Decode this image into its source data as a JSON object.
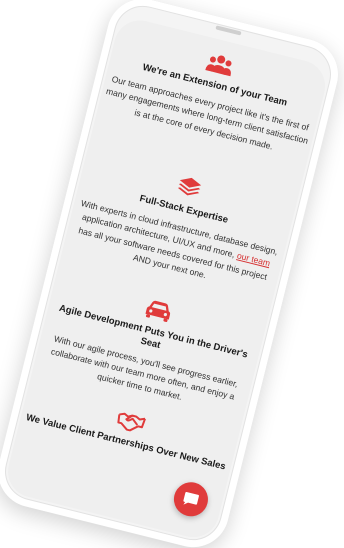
{
  "features": [
    {
      "icon": "users-icon",
      "title": "We're an Extension of your Team",
      "text": "Our team approaches every project like it's the first of many engagements where long-term client satisfaction is at the core of every decision made."
    },
    {
      "icon": "layers-icon",
      "title": "Full-Stack Expertise",
      "text_before": "With experts in cloud infrastructure, database design, application architecture, UI/UX and more,",
      "link": "our team",
      "text_after": "has all your software needs covered for this project AND your next one."
    },
    {
      "icon": "car-icon",
      "title": "Agile Development Puts You in the Driver's Seat",
      "text": "With our agile process, you'll see progress earlier, collaborate with our team more often, and enjoy a quicker time to market."
    },
    {
      "icon": "handshake-icon",
      "title": "We Value Client Partnerships Over New Sales"
    }
  ],
  "chat": {
    "icon": "chat-icon"
  },
  "colors": {
    "accent": "#e03b3b",
    "link": "#d63031"
  }
}
